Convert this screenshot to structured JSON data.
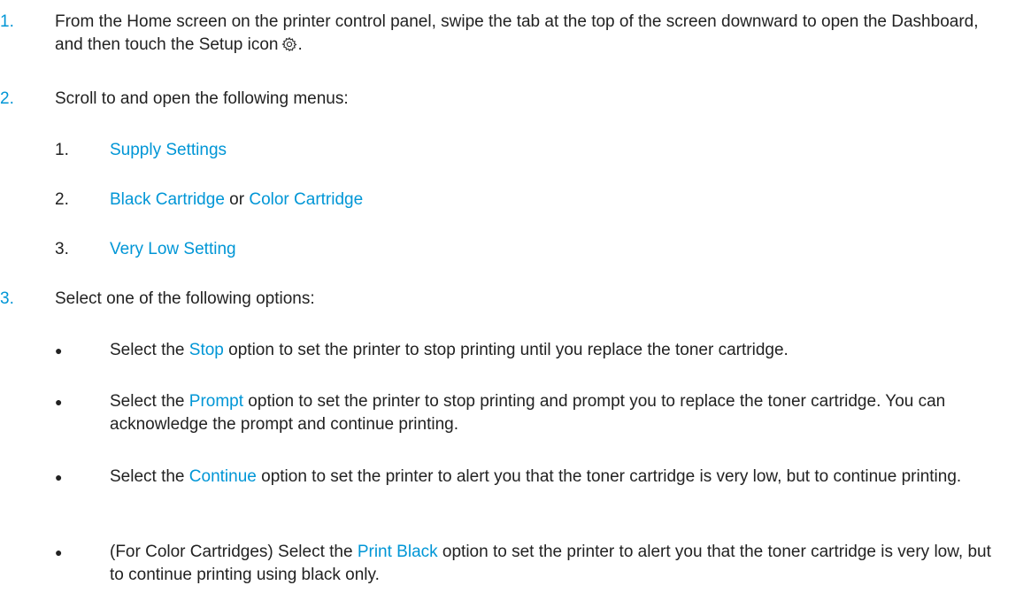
{
  "colors": {
    "accent": "#0096d6",
    "text": "#222222"
  },
  "steps": [
    {
      "number": "1.",
      "text_before": "From the Home screen on the printer control panel, swipe the tab at the top of the screen downward to open the Dashboard, and then touch the Setup icon",
      "icon": "gear-icon",
      "text_after": "."
    },
    {
      "number": "2.",
      "text": "Scroll to and open the following menus:",
      "substeps": [
        {
          "number": "1.",
          "link1": "Supply Settings"
        },
        {
          "number": "2.",
          "link1": "Black Cartridge",
          "joiner": " or ",
          "link2": "Color Cartridge"
        },
        {
          "number": "3.",
          "link1": "Very Low Setting"
        }
      ]
    },
    {
      "number": "3.",
      "text": "Select one of the following options:",
      "bullets": [
        {
          "bullet": "●",
          "before": "Select the ",
          "link": "Stop",
          "after": " option to set the printer to stop printing until you replace the toner cartridge."
        },
        {
          "bullet": "●",
          "before": "Select the ",
          "link": "Prompt",
          "after": " option to set the printer to stop printing and prompt you to replace the toner cartridge. You can acknowledge the prompt and continue printing."
        },
        {
          "bullet": "●",
          "before": "Select the ",
          "link": "Continue",
          "after": " option to set the printer to alert you that the toner cartridge is very low, but to continue printing."
        },
        {
          "bullet": "●",
          "before": "(For Color Cartridges) Select the ",
          "link": "Print Black",
          "after": " option to set the printer to alert you that the toner cartridge is very low, but to continue printing using black only."
        }
      ]
    }
  ]
}
